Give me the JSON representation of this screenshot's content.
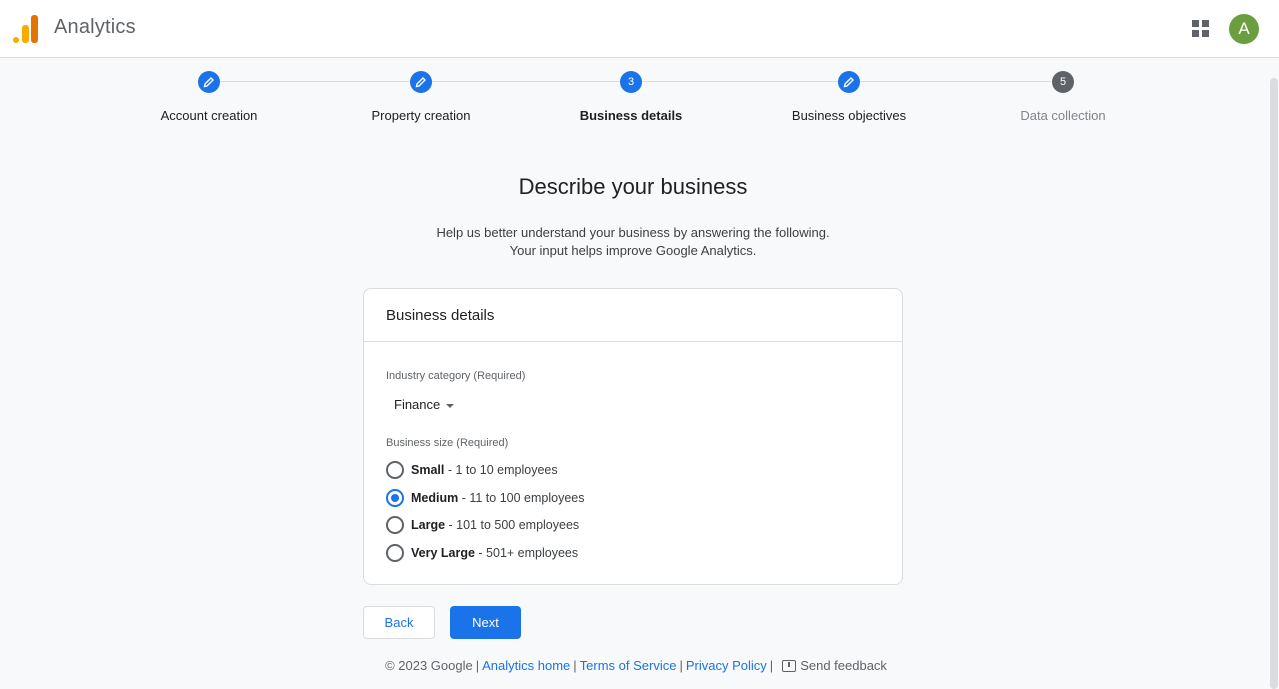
{
  "header": {
    "app_title": "Analytics",
    "avatar_letter": "A"
  },
  "stepper": {
    "steps": [
      {
        "label": "Account creation",
        "state": "done",
        "number": ""
      },
      {
        "label": "Property creation",
        "state": "done",
        "number": ""
      },
      {
        "label": "Business details",
        "state": "current",
        "number": "3"
      },
      {
        "label": "Business objectives",
        "state": "done",
        "number": ""
      },
      {
        "label": "Data collection",
        "state": "todo",
        "number": "5"
      }
    ]
  },
  "main": {
    "headline": "Describe your business",
    "subtext_line1": "Help us better understand your business by answering the following.",
    "subtext_line2": "Your input helps improve Google Analytics."
  },
  "card": {
    "title": "Business details",
    "industry_label": "Industry category (Required)",
    "industry_value": "Finance",
    "size_label": "Business size (Required)",
    "size_options": [
      {
        "name": "Small",
        "detail": " - 1 to 10 employees",
        "checked": false
      },
      {
        "name": "Medium",
        "detail": " - 11 to 100 employees",
        "checked": true
      },
      {
        "name": "Large",
        "detail": " - 101 to 500 employees",
        "checked": false
      },
      {
        "name": "Very Large",
        "detail": " - 501+ employees",
        "checked": false
      }
    ]
  },
  "buttons": {
    "back": "Back",
    "next": "Next"
  },
  "footer": {
    "copyright": "© 2023 Google",
    "analytics_home": "Analytics home",
    "terms": "Terms of Service",
    "privacy": "Privacy Policy",
    "feedback": "Send feedback"
  },
  "colors": {
    "accent": "#1a73e8",
    "avatar_bg": "#6a9e3f",
    "logo_orange": "#f9ab00",
    "logo_dark_orange": "#e37400"
  }
}
